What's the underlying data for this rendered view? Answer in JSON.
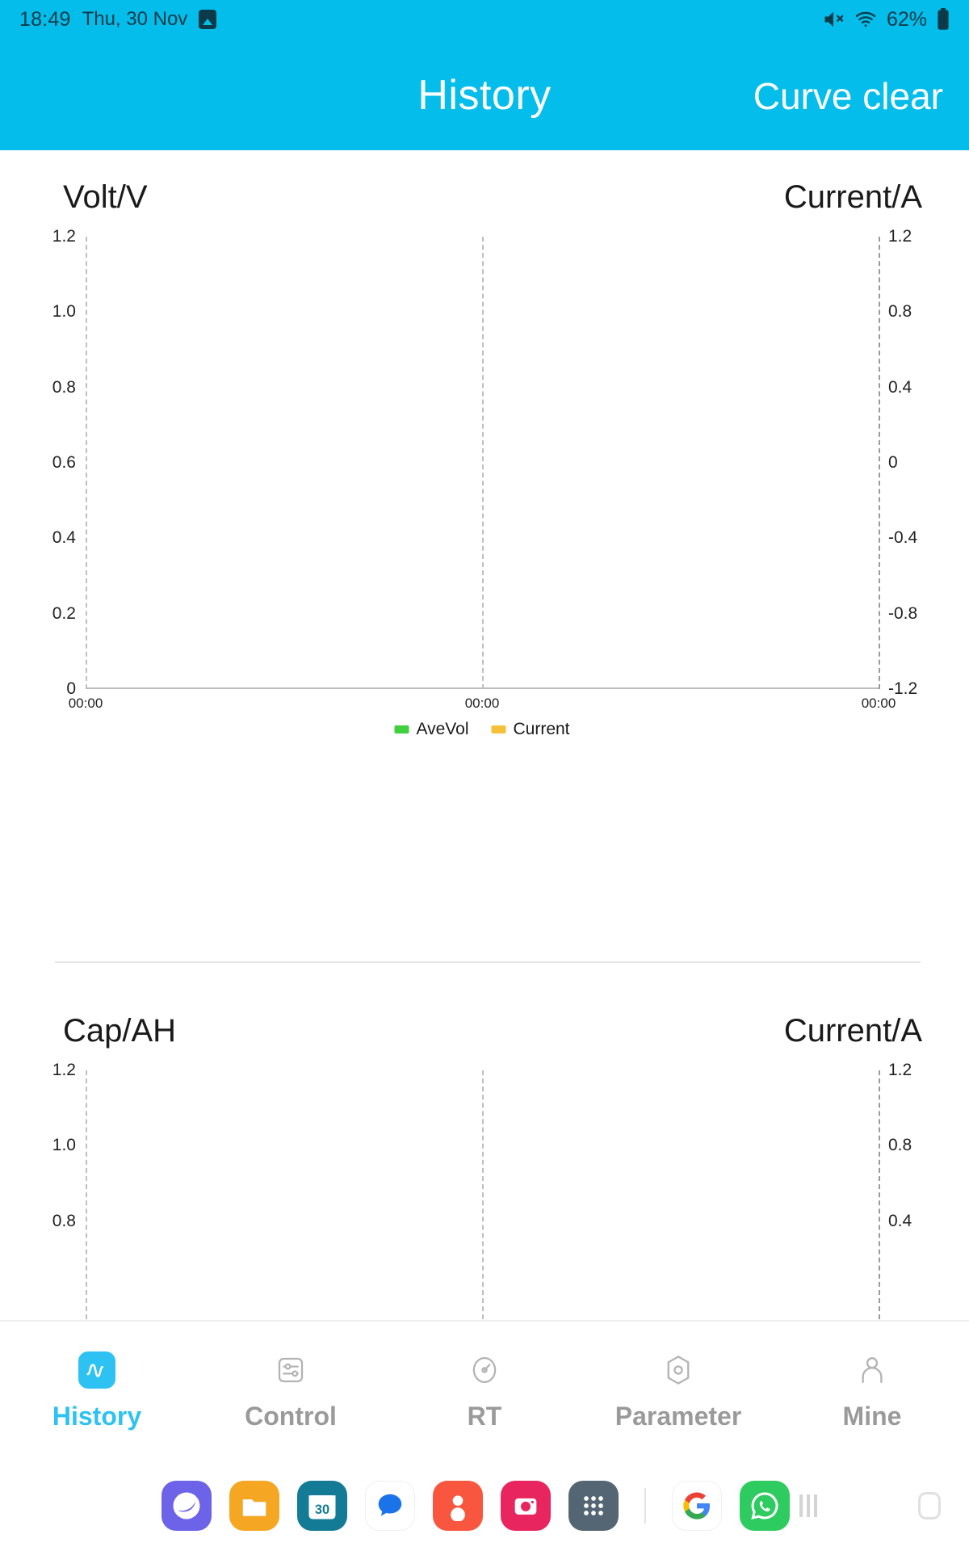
{
  "statusbar": {
    "time": "18:49",
    "date": "Thu, 30 Nov",
    "image_icon": "image-icon",
    "mute_icon": "mute-icon",
    "wifi_icon": "wifi-icon",
    "battery_percent": "62%",
    "battery_icon": "battery-icon"
  },
  "appbar": {
    "title": "History",
    "action_label": "Curve clear",
    "background": "#04bdeb",
    "text_color": "#ffffff"
  },
  "chart_data": [
    {
      "type": "line",
      "title": "",
      "left_axis_label": "Volt/V",
      "right_axis_label": "Current/A",
      "left_ticks": [
        "1.2",
        "1.0",
        "0.8",
        "0.6",
        "0.4",
        "0.2",
        "0"
      ],
      "left_tick_values": [
        1.2,
        1.0,
        0.8,
        0.6,
        0.4,
        0.2,
        0
      ],
      "right_ticks": [
        "1.2",
        "0.8",
        "0.4",
        "0",
        "-0.4",
        "-0.8",
        "-1.2"
      ],
      "right_tick_values": [
        1.2,
        0.8,
        0.4,
        0,
        -0.4,
        -0.8,
        -1.2
      ],
      "ylim_left": [
        0,
        1.2
      ],
      "ylim_right": [
        -1.2,
        1.2
      ],
      "x_ticks": [
        "00:00",
        "00:00",
        "00:00"
      ],
      "x": [],
      "series": [
        {
          "name": "AveVol",
          "color": "#3fcf3f",
          "values": []
        },
        {
          "name": "Current",
          "color": "#f5c13a",
          "values": []
        }
      ],
      "legend_position": "bottom-center",
      "grid": "dashed-vertical",
      "xlabel": "",
      "ylabel": ""
    },
    {
      "type": "line",
      "title": "",
      "left_axis_label": "Cap/AH",
      "right_axis_label": "Current/A",
      "left_ticks": [
        "1.2",
        "1.0",
        "0.8"
      ],
      "left_tick_values": [
        1.2,
        1.0,
        0.8
      ],
      "right_ticks": [
        "1.2",
        "0.8",
        "0.4"
      ],
      "right_tick_values": [
        1.2,
        0.8,
        0.4
      ],
      "ylim_left": [
        0,
        1.2
      ],
      "ylim_right": [
        -1.2,
        1.2
      ],
      "x_ticks": [],
      "x": [],
      "series": [],
      "legend_position": "bottom-center",
      "grid": "dashed-vertical",
      "xlabel": "",
      "ylabel": ""
    }
  ],
  "tabbar": {
    "items": [
      {
        "label": "History",
        "icon": "wave-chart-icon",
        "active": true
      },
      {
        "label": "Control",
        "icon": "sliders-icon",
        "active": false
      },
      {
        "label": "RT",
        "icon": "gauge-icon",
        "active": false
      },
      {
        "label": "Parameter",
        "icon": "hexagon-icon",
        "active": false
      },
      {
        "label": "Mine",
        "icon": "person-icon",
        "active": false
      }
    ],
    "active_color": "#2ec2f2",
    "inactive_color": "#9a9a9a"
  },
  "dock": {
    "apps": [
      {
        "name": "samsung-internet-icon",
        "color": "#6c63e8"
      },
      {
        "name": "my-files-icon",
        "color": "#f5a623"
      },
      {
        "name": "calendar-icon",
        "color": "#137b96",
        "badge": "30"
      },
      {
        "name": "messages-icon",
        "color": "#ffffff"
      },
      {
        "name": "contacts-icon",
        "color": "#f9563f"
      },
      {
        "name": "camera-icon",
        "color": "#e8255f"
      },
      {
        "name": "apps-drawer-icon",
        "color": "#546673"
      },
      {
        "name": "google-icon",
        "color": "#ffffff"
      },
      {
        "name": "whatsapp-icon",
        "color": "#2ecc60"
      }
    ],
    "navkeys": [
      {
        "name": "recents-key"
      },
      {
        "name": "home-key"
      },
      {
        "name": "back-key"
      }
    ]
  }
}
